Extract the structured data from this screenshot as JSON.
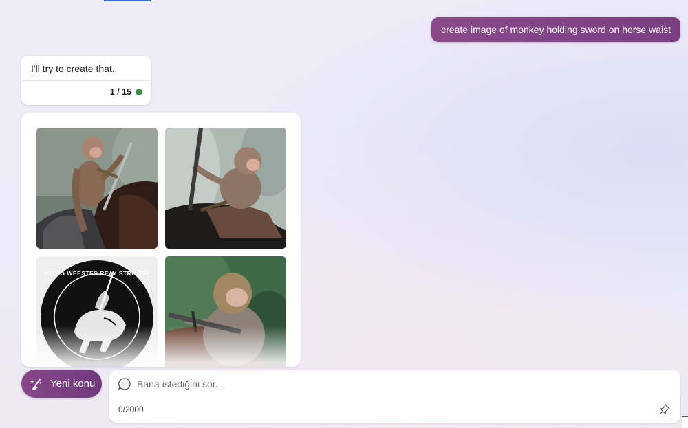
{
  "conversation": {
    "user_message": "create image of monkey holding sword on horse waist",
    "bot_message": "I'll try to create that.",
    "turn_counter": "1 / 15",
    "status_color": "#3e8f4c"
  },
  "images": [
    {
      "name": "monkey-with-sword-on-horse-1",
      "depicts": "monkey sitting on saddled brown horse raising sword"
    },
    {
      "name": "monkey-with-sword-on-horse-2",
      "depicts": "monkey on saddle gripping long sword"
    },
    {
      "name": "monkey-badge-emblem",
      "depicts": "black circular badge with white horse and rider"
    },
    {
      "name": "monkey-with-sword-on-horse-3",
      "depicts": "close-up monkey holding sword on horse"
    }
  ],
  "badge_text": "ME GG WEESTES REAY STROOBE",
  "composer": {
    "new_topic_label": "Yeni konu",
    "placeholder": "Bana istediğini sor...",
    "char_counter": "0/2000"
  },
  "colors": {
    "accent_purple": "#7a3e82",
    "status_green": "#3e8f4c"
  }
}
